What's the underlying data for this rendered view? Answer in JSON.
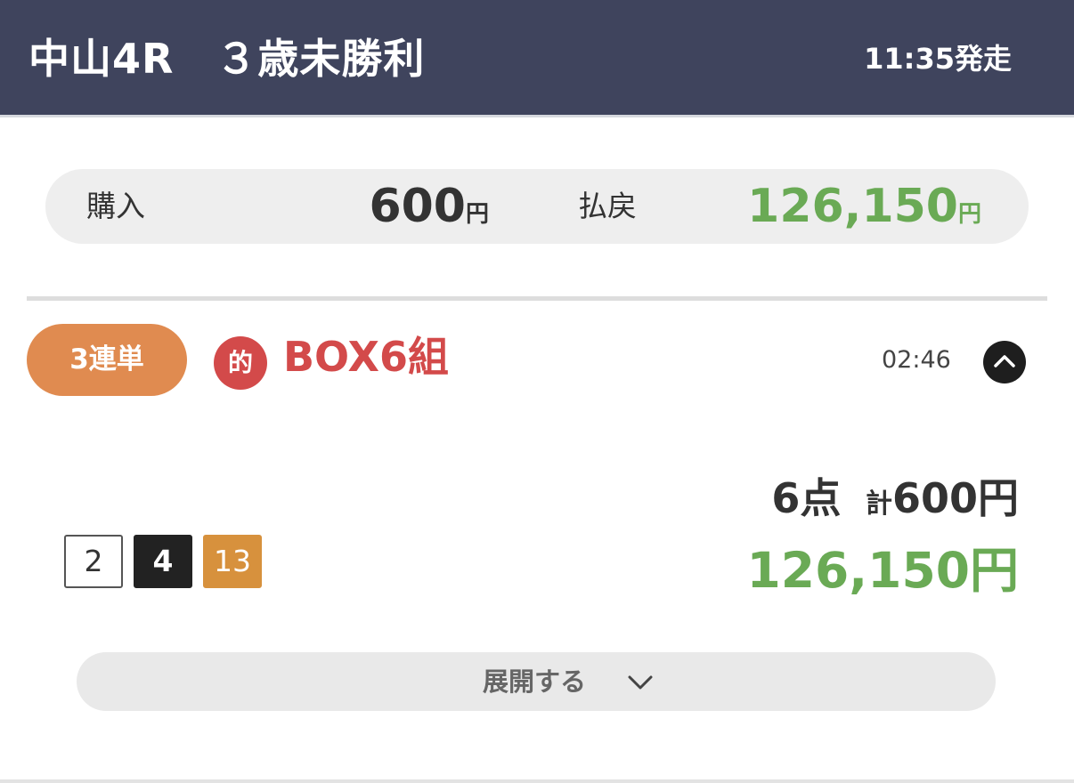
{
  "header": {
    "title": "中山4R　３歳未勝利",
    "post_time": "11:35発走",
    "background_color": "#3f445d"
  },
  "summary": {
    "purchase_label": "購入",
    "purchase_amount": "600",
    "purchase_unit": "円",
    "payout_label": "払戻",
    "payout_amount": "126,150",
    "payout_unit": "円",
    "payout_color": "#6aaa55"
  },
  "bet": {
    "type_label": "3連単",
    "type_color": "#e08b50",
    "hit_badge": "的",
    "hit_color": "#d34a4a",
    "title": "BOX6組",
    "time": "02:46",
    "points": "6点",
    "total_prefix": "計",
    "total_amount": "600円",
    "payout": "126,150円",
    "horses": [
      "2",
      "4",
      "13"
    ],
    "horse_colors": [
      "#ffffff",
      "#222222",
      "#d7913d"
    ]
  },
  "expand": {
    "label": "展開する",
    "icon": "chevron-down-icon"
  },
  "collapse_icon": "chevron-up-icon"
}
